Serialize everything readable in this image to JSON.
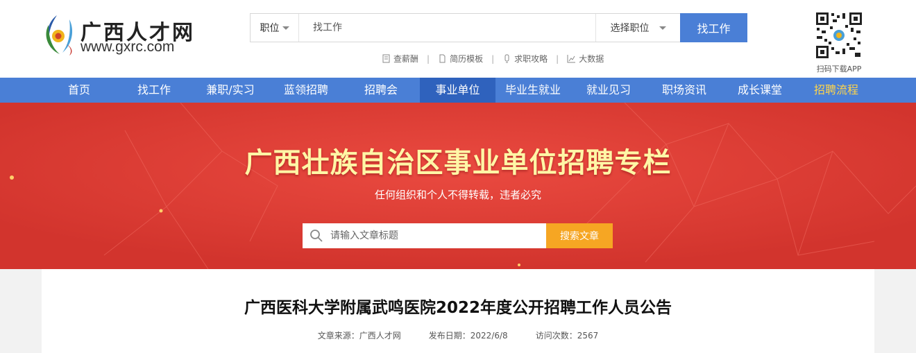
{
  "header": {
    "logo_cn": "广西人才网",
    "logo_en": "www.gxrc.com",
    "search": {
      "type_label": "职位",
      "placeholder": "找工作",
      "position_label": "选择职位",
      "button_label": "找工作"
    },
    "quick_links": [
      {
        "label": "查薪酬",
        "icon": "document-icon"
      },
      {
        "label": "简历模板",
        "icon": "file-icon"
      },
      {
        "label": "求职攻略",
        "icon": "lightbulb-icon"
      },
      {
        "label": "大数据",
        "icon": "chart-icon"
      }
    ],
    "qr_caption": "扫码下载APP"
  },
  "nav": {
    "items": [
      {
        "label": "首页"
      },
      {
        "label": "找工作"
      },
      {
        "label": "兼职/实习"
      },
      {
        "label": "蓝领招聘"
      },
      {
        "label": "招聘会"
      },
      {
        "label": "事业单位",
        "active": true
      },
      {
        "label": "毕业生就业"
      },
      {
        "label": "就业见习"
      },
      {
        "label": "职场资讯"
      },
      {
        "label": "成长课堂"
      },
      {
        "label": "招聘流程",
        "highlight": true
      }
    ]
  },
  "banner": {
    "title": "广西壮族自治区事业单位招聘专栏",
    "subtitle": "任何组织和个人不得转载，违者必究",
    "search_placeholder": "请输入文章标题",
    "search_button": "搜索文章"
  },
  "article": {
    "title": "广西医科大学附属武鸣医院2022年度公开招聘工作人员公告",
    "source": "文章来源：广西人才网",
    "date": "发布日期：2022/6/8",
    "views": "访问次数：2567"
  },
  "colors": {
    "nav_bg": "#4a7fd6",
    "nav_active": "#2f62bd",
    "banner_bg": "#de3d35",
    "banner_title": "#fff6a6",
    "search_button": "#f6a623"
  }
}
